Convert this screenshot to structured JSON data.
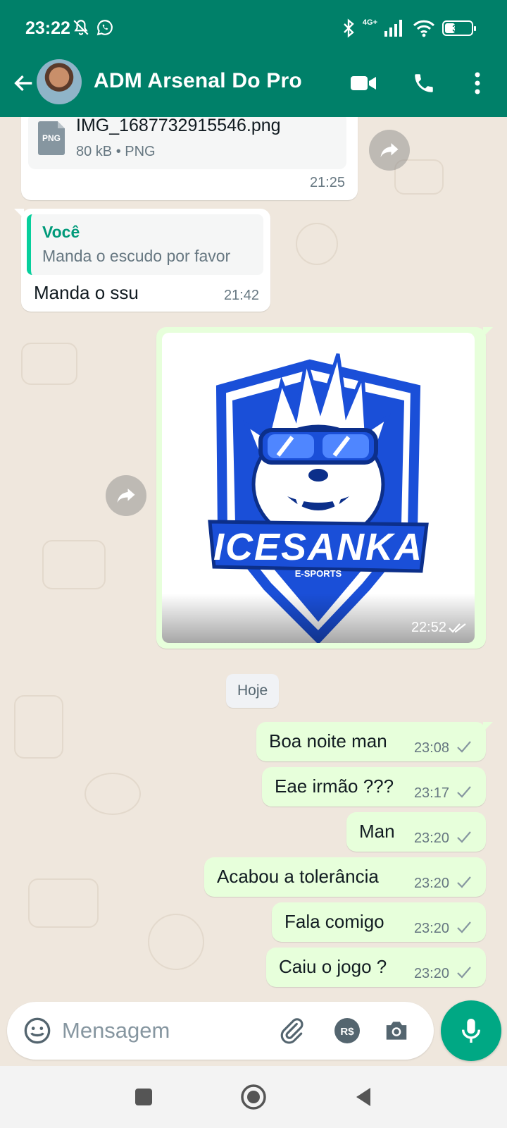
{
  "status_bar": {
    "time": "23:22",
    "network": "4G+",
    "battery": "39",
    "battery_level": 0.39
  },
  "header": {
    "contact_name": "ADM Arsenal Do Pro"
  },
  "messages": {
    "file": {
      "name": "IMG_1687732915546.png",
      "meta": "80 kB • PNG",
      "icon_label": "PNG",
      "time": "21:25"
    },
    "reply": {
      "quote_author": "Você",
      "quote_text": "Manda o escudo por favor",
      "text": "Manda o ssu",
      "time": "21:42"
    },
    "image": {
      "logo_text": "ICESANKA",
      "logo_subtext": "E-SPORTS",
      "time": "22:52"
    },
    "date_separator": "Hoje",
    "outgoing": [
      {
        "text": "Boa noite man",
        "time": "23:08"
      },
      {
        "text": "Eae irmão ???",
        "time": "23:17"
      },
      {
        "text": "Man",
        "time": "23:20"
      },
      {
        "text": "Acabou a tolerância",
        "time": "23:20"
      },
      {
        "text": "Fala comigo",
        "time": "23:20"
      },
      {
        "text": "Caiu o jogo ?",
        "time": "23:20"
      }
    ]
  },
  "composer": {
    "placeholder": "Mensagem",
    "payment_label": "R$"
  },
  "icons": {
    "header": [
      "back-arrow-icon",
      "video-call-icon",
      "phone-icon",
      "more-vert-icon"
    ],
    "composer": [
      "emoji-icon",
      "attach-icon",
      "payment-icon",
      "camera-icon",
      "mic-icon"
    ],
    "nav": [
      "recents-icon",
      "home-icon",
      "back-icon"
    ]
  },
  "colors": {
    "header": "#008069",
    "outgoing_bubble": "#e7ffdb",
    "incoming_bubble": "#ffffff",
    "accent": "#00a884",
    "quote_bar": "#06cf9c",
    "logo_blue": "#1a4fd8"
  }
}
